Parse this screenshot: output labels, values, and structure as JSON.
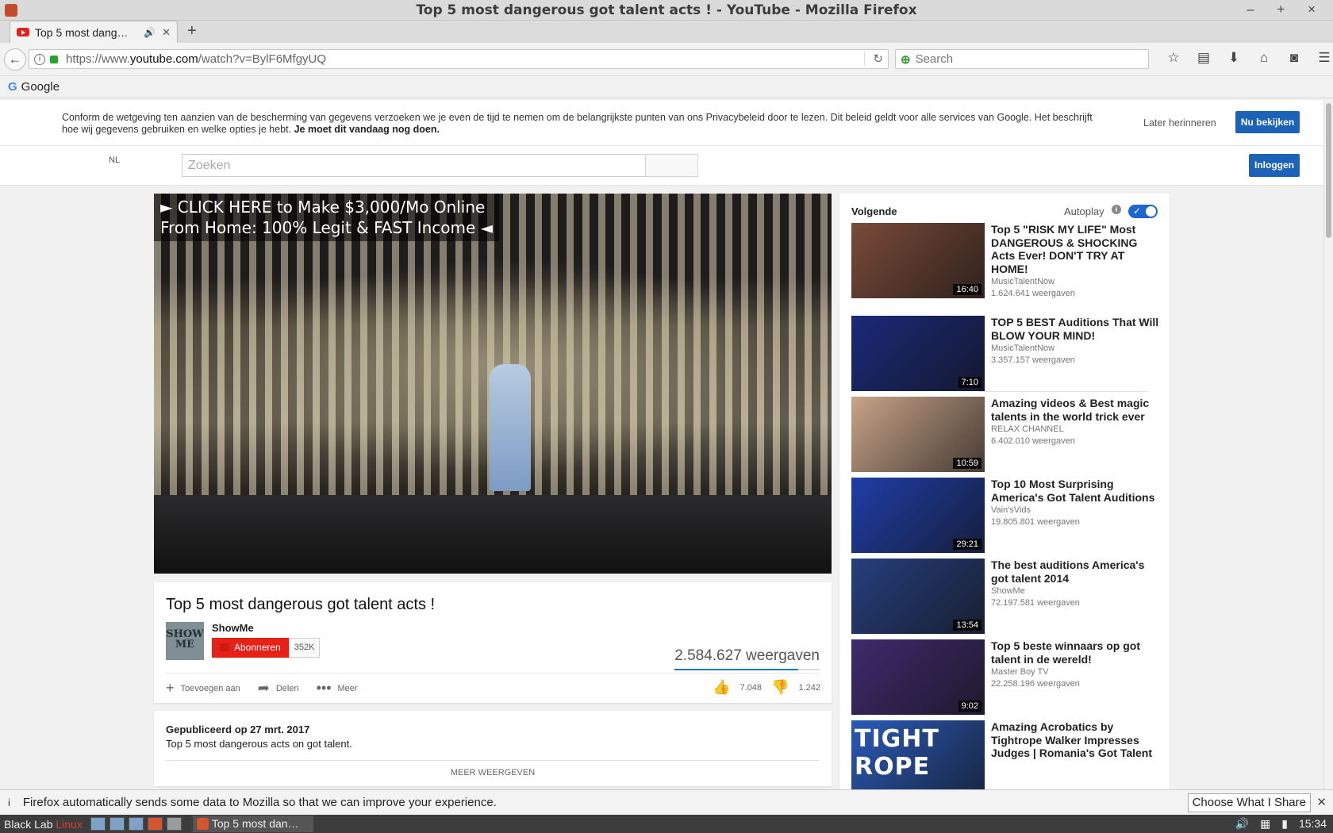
{
  "window": {
    "title": "Top 5 most dangerous got talent acts ! - YouTube - Mozilla Firefox",
    "controls": "– + ×"
  },
  "tab": {
    "title": "Top 5 most dangerous got talent acts !",
    "display": "Top 5 most dang…"
  },
  "navbar": {
    "url_prefix": "https://www.",
    "url_domain": "youtube.com",
    "url_path": "/watch?v=BylF6MfgyUQ",
    "search_placeholder": "Search"
  },
  "bookmarks": {
    "google": "Google"
  },
  "consent": {
    "message": "Conform de wetgeving ten aanzien van de bescherming van gegevens verzoeken we je even de tijd te nemen om de belangrijkste punten van ons Privacybeleid door te lezen. Dit beleid geldt voor alle services van Google. Het beschrijft hoe wij gegevens gebruiken en welke opties je hebt.",
    "message_bold": "Je moet dit vandaag nog doen.",
    "later": "Later herinneren",
    "view": "Nu bekijken"
  },
  "masthead": {
    "lang": "NL",
    "search_placeholder": "Zoeken",
    "login": "Inloggen"
  },
  "player": {
    "ad_line1": "► CLICK HERE to Make $3,000/Mo Online",
    "ad_line2": "From Home: 100% Legit & FAST Income ◄"
  },
  "video": {
    "title": "Top 5 most dangerous got talent acts !",
    "channel": "ShowMe",
    "avatar_text": "SHOW ME",
    "subscribe": "Abonneren",
    "subscribers": "352K",
    "views": "2.584.627 weergaven",
    "like_ratio": 0.85,
    "actions": {
      "add": "Toevoegen aan",
      "share": "Delen",
      "more": "Meer"
    },
    "likes": "7.048",
    "dislikes": "1.242",
    "published": "Gepubliceerd op 27 mrt. 2017",
    "description": "Top 5 most dangerous acts on got talent.",
    "show_more": "MEER WEERGEVEN"
  },
  "sidebar": {
    "next": "Volgende",
    "autoplay": "Autoplay",
    "autoplay_on": true,
    "items": [
      {
        "title": "Top 5 \"RISK MY LIFE\" Most DANGEROUS & SHOCKING Acts Ever! DON'T TRY AT HOME!",
        "channel": "MusicTalentNow",
        "views": "1.624.641 weergaven",
        "duration": "16:40",
        "color": "#7a4b3a"
      },
      {
        "title": "TOP 5 BEST Auditions That Will BLOW YOUR MIND!",
        "channel": "MusicTalentNow",
        "views": "3.357.157 weergaven",
        "duration": "7:10",
        "color": "#1b2a7a"
      },
      {
        "title": "Amazing videos & Best magic talents in the world trick ever",
        "channel": "RELAX CHANNEL",
        "views": "6.402.010 weergaven",
        "duration": "10:59",
        "color": "#c9a489"
      },
      {
        "title": "Top 10 Most Surprising America's Got Talent Auditions",
        "channel": "Vain'sVids",
        "views": "19.805.801 weergaven",
        "duration": "29:21",
        "color": "#1f3ea8"
      },
      {
        "title": "The best auditions America's got talent 2014",
        "channel": "ShowMe",
        "views": "72.197.581 weergaven",
        "duration": "13:54",
        "color": "#263f7e"
      },
      {
        "title": "Top 5 beste winnaars op got talent in de wereld!",
        "channel": "Master Boy TV",
        "views": "22.258.196 weergaven",
        "duration": "9:02",
        "color": "#402a6e"
      },
      {
        "title": "Amazing Acrobatics by Tightrope Walker Impresses Judges | Romania's Got Talent",
        "channel": "",
        "views": "",
        "duration": "",
        "color": "#2a5ab8",
        "thumb_text": "TIGHT ROPE"
      }
    ]
  },
  "notification": {
    "icon": "i",
    "text": "Firefox automatically sends some data to Mozilla so that we can improve your experience.",
    "button": "Choose What I Share"
  },
  "taskbar": {
    "start_white": "Black Lab ",
    "start_red": "Linux",
    "task": "Top 5 most dan…",
    "clock": "15:34"
  }
}
